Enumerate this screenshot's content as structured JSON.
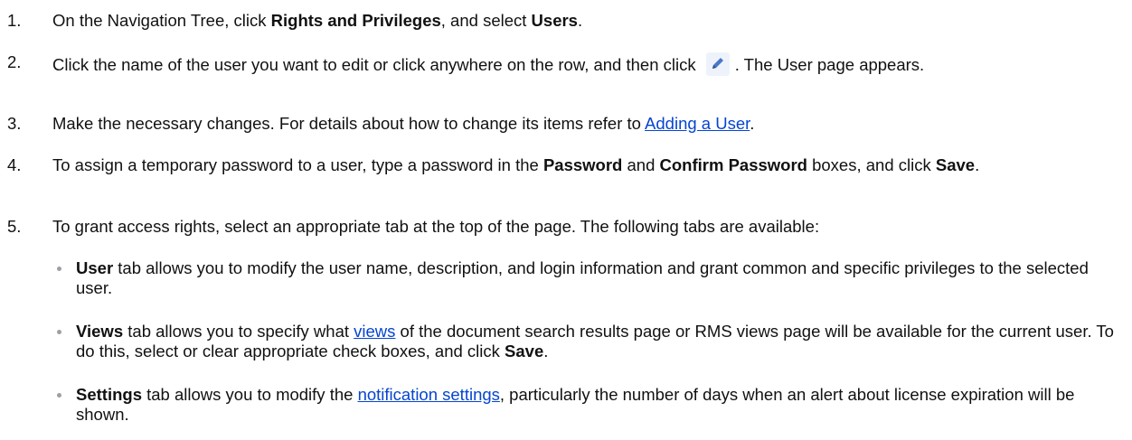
{
  "steps": [
    {
      "num": "1.",
      "t1": "On the Navigation Tree, click ",
      "b1": "Rights and Privileges",
      "t2": ", and select ",
      "b2": "Users",
      "t3": "."
    },
    {
      "num": "2.",
      "t1": "Click the name of the user you want to edit or click anywhere on the row, and then click ",
      "t2": ". The User page appears.",
      "icon": "pencil-edit-icon"
    },
    {
      "num": "3.",
      "t1": "Make the necessary changes. For details about how to change its items refer to ",
      "link": "Adding a User",
      "t2": "."
    },
    {
      "num": "4.",
      "t1": "To assign a temporary password to a user, type a password in the ",
      "b1": "Password",
      "t2": " and ",
      "b2": "Confirm Password",
      "t3": " boxes, and click ",
      "b3": "Save",
      "t4": "."
    },
    {
      "num": "5.",
      "t1": "To grant access rights, select an appropriate tab at the top of the page. The following tabs are available:"
    }
  ],
  "bullets": [
    {
      "b1": "User",
      "t1": " tab allows you to modify the user name, description, and login information and grant common and specific privileges to the selected user."
    },
    {
      "b1": "Views",
      "t1": " tab allows you to specify what ",
      "link": "views",
      "t2": " of the document search results page or RMS views page will be available for the current user. To do this, select or clear appropriate check boxes, and click ",
      "b2": "Save",
      "t3": "."
    },
    {
      "b1": "Settings",
      "t1": " tab allows you to modify the ",
      "link": "notification settings",
      "t2": ", particularly the number of days when an alert about license expiration will be shown."
    }
  ],
  "colors": {
    "link": "#0645d0",
    "bullet": "#9aa0a6",
    "text": "#111111"
  }
}
